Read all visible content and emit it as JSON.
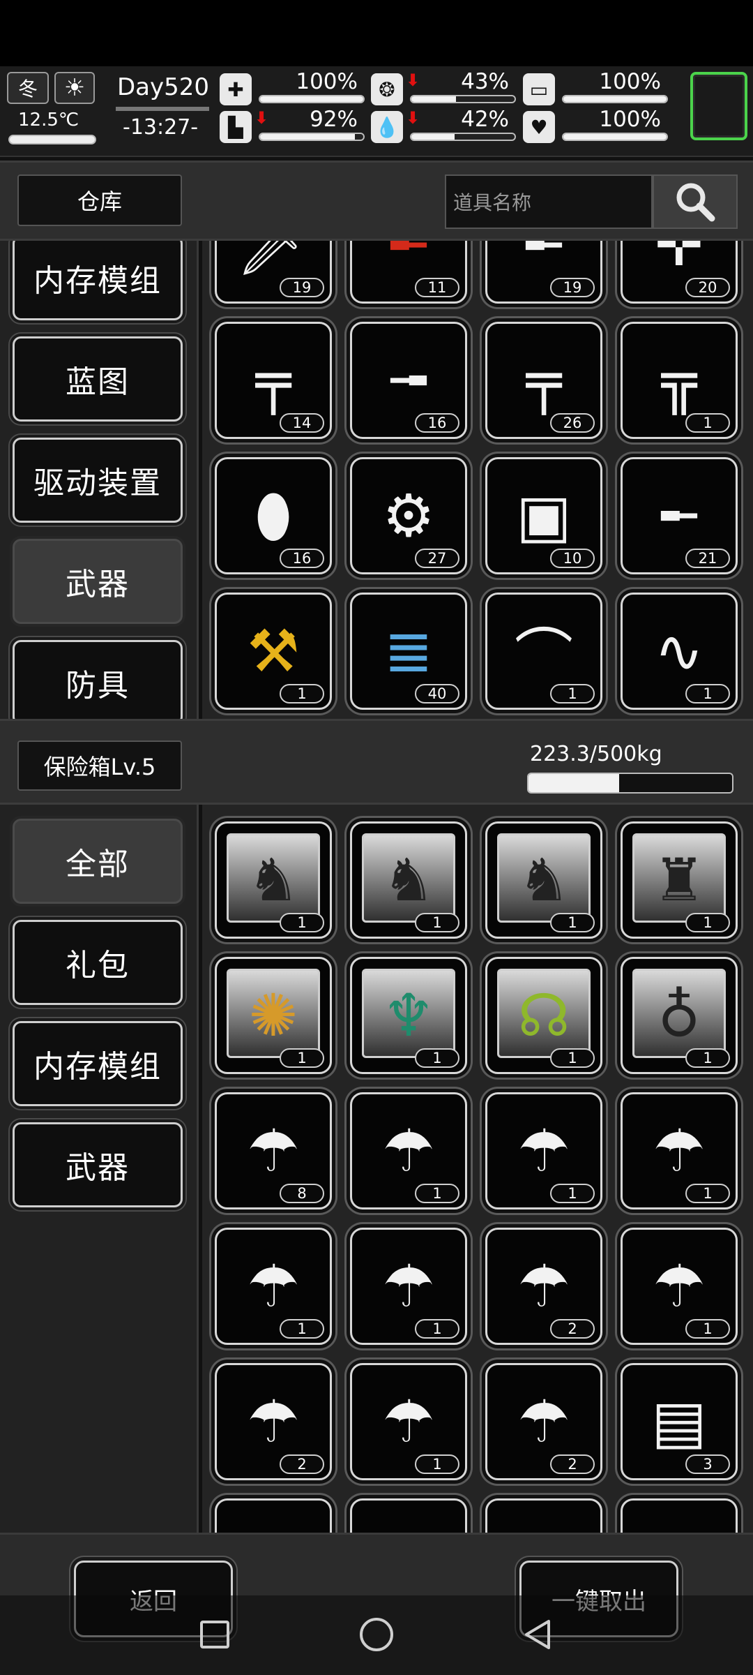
{
  "hud": {
    "season": "冬",
    "weather_icon": "sun-icon",
    "temperature": "12.5℃",
    "day": "Day520",
    "time": "-13:27-",
    "stats": [
      {
        "id": "health",
        "icon": "medkit-icon",
        "value": "100%",
        "level": 1.0,
        "warning": false
      },
      {
        "id": "hunger",
        "icon": "stomach-icon",
        "value": "43%",
        "level": 0.43,
        "warning": true
      },
      {
        "id": "stamina",
        "icon": "battery-icon",
        "value": "100%",
        "level": 1.0,
        "warning": false
      },
      {
        "id": "leg",
        "icon": "boot-icon",
        "value": "92%",
        "level": 0.92,
        "warning": true
      },
      {
        "id": "thirst",
        "icon": "water-drop-icon",
        "value": "42%",
        "level": 0.42,
        "warning": true
      },
      {
        "id": "mood",
        "icon": "heart-icon",
        "value": "100%",
        "level": 1.0,
        "warning": false
      }
    ],
    "accent_color": "#4bd34b"
  },
  "warehouse": {
    "title": "仓库",
    "search_placeholder": "道具名称",
    "categories": [
      {
        "label": "内存模组",
        "active": false
      },
      {
        "label": "蓝图",
        "active": false
      },
      {
        "label": "驱动装置",
        "active": false
      },
      {
        "label": "武器",
        "active": true
      },
      {
        "label": "防具",
        "active": false
      }
    ],
    "items": [
      {
        "icon": "machete-icon",
        "count": "19"
      },
      {
        "icon": "red-shotgun-icon",
        "count": "11"
      },
      {
        "icon": "shotgun-icon",
        "count": "19"
      },
      {
        "icon": "crossbow-icon",
        "count": "20"
      },
      {
        "icon": "assault-rifle-icon",
        "count": "14"
      },
      {
        "icon": "bolt-rifle-icon",
        "count": "16"
      },
      {
        "icon": "battle-rifle-icon",
        "count": "26"
      },
      {
        "icon": "scar-rifle-icon",
        "count": "1"
      },
      {
        "icon": "riot-shield-icon",
        "count": "16"
      },
      {
        "icon": "chainsaw-icon",
        "count": "27"
      },
      {
        "icon": "tactical-shield-icon",
        "count": "10"
      },
      {
        "icon": "sniper-rifle-icon",
        "count": "21"
      },
      {
        "icon": "golden-hammer-icon",
        "count": "1"
      },
      {
        "icon": "minigun-icon",
        "count": "40"
      },
      {
        "icon": "compound-bow-icon",
        "count": "1"
      },
      {
        "icon": "chain-whip-icon",
        "count": "1"
      }
    ]
  },
  "safe": {
    "title": "保险箱Lv.5",
    "weight_text": "223.3/500kg",
    "weight_fraction": 0.4466,
    "categories": [
      {
        "label": "全部",
        "active": true
      },
      {
        "label": "礼包",
        "active": false
      },
      {
        "label": "内存模组",
        "active": false
      },
      {
        "label": "武器",
        "active": false
      }
    ],
    "items": [
      {
        "icon": "armored-skin-gift-icon",
        "count": "1",
        "framed": true
      },
      {
        "icon": "armored-skin-teal-icon",
        "count": "1",
        "framed": true
      },
      {
        "icon": "armored-skin-gold-icon",
        "count": "1",
        "framed": true
      },
      {
        "icon": "motorcycle-skin-icon",
        "count": "1",
        "framed": true
      },
      {
        "icon": "feather-skin-icon",
        "count": "1",
        "framed": true
      },
      {
        "icon": "dragon-skin-icon",
        "count": "1",
        "framed": true
      },
      {
        "icon": "snake-skin-icon",
        "count": "1",
        "framed": true
      },
      {
        "icon": "balloon-skin-icon",
        "count": "1",
        "framed": true
      },
      {
        "icon": "airdrop-car-icon",
        "count": "8",
        "framed": false
      },
      {
        "icon": "airdrop-motorbike-icon",
        "count": "1",
        "framed": false
      },
      {
        "icon": "airdrop-atv-icon",
        "count": "1",
        "framed": false
      },
      {
        "icon": "airdrop-motorbike-icon",
        "count": "1",
        "framed": false
      },
      {
        "icon": "airdrop-motorbike-icon",
        "count": "1",
        "framed": false
      },
      {
        "icon": "airdrop-bicycle-icon",
        "count": "1",
        "framed": false
      },
      {
        "icon": "airdrop-car-icon",
        "count": "2",
        "framed": false
      },
      {
        "icon": "airdrop-car-icon",
        "count": "1",
        "framed": false
      },
      {
        "icon": "airdrop-motorbike-icon",
        "count": "2",
        "framed": false
      },
      {
        "icon": "airdrop-car-icon",
        "count": "1",
        "framed": false
      },
      {
        "icon": "airdrop-car-icon",
        "count": "2",
        "framed": false
      },
      {
        "icon": "memory-module-icon",
        "count": "3",
        "framed": false
      }
    ]
  },
  "footer": {
    "back_label": "返回",
    "take_all_label": "一键取出"
  },
  "navbar": {
    "icons": [
      "recents-icon",
      "home-icon",
      "back-icon"
    ]
  }
}
